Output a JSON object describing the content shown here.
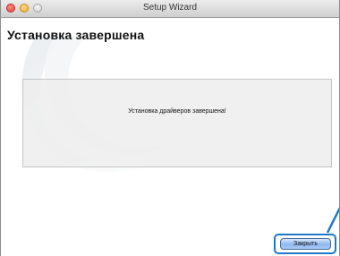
{
  "window": {
    "title": "Setup Wizard"
  },
  "heading": "Установка завершена",
  "message": "Установка драйверов завершена!",
  "buttons": {
    "close_label": "Закрыть"
  },
  "colors": {
    "highlight": "#1f79c6",
    "button_fill": "#a9cbf6"
  }
}
